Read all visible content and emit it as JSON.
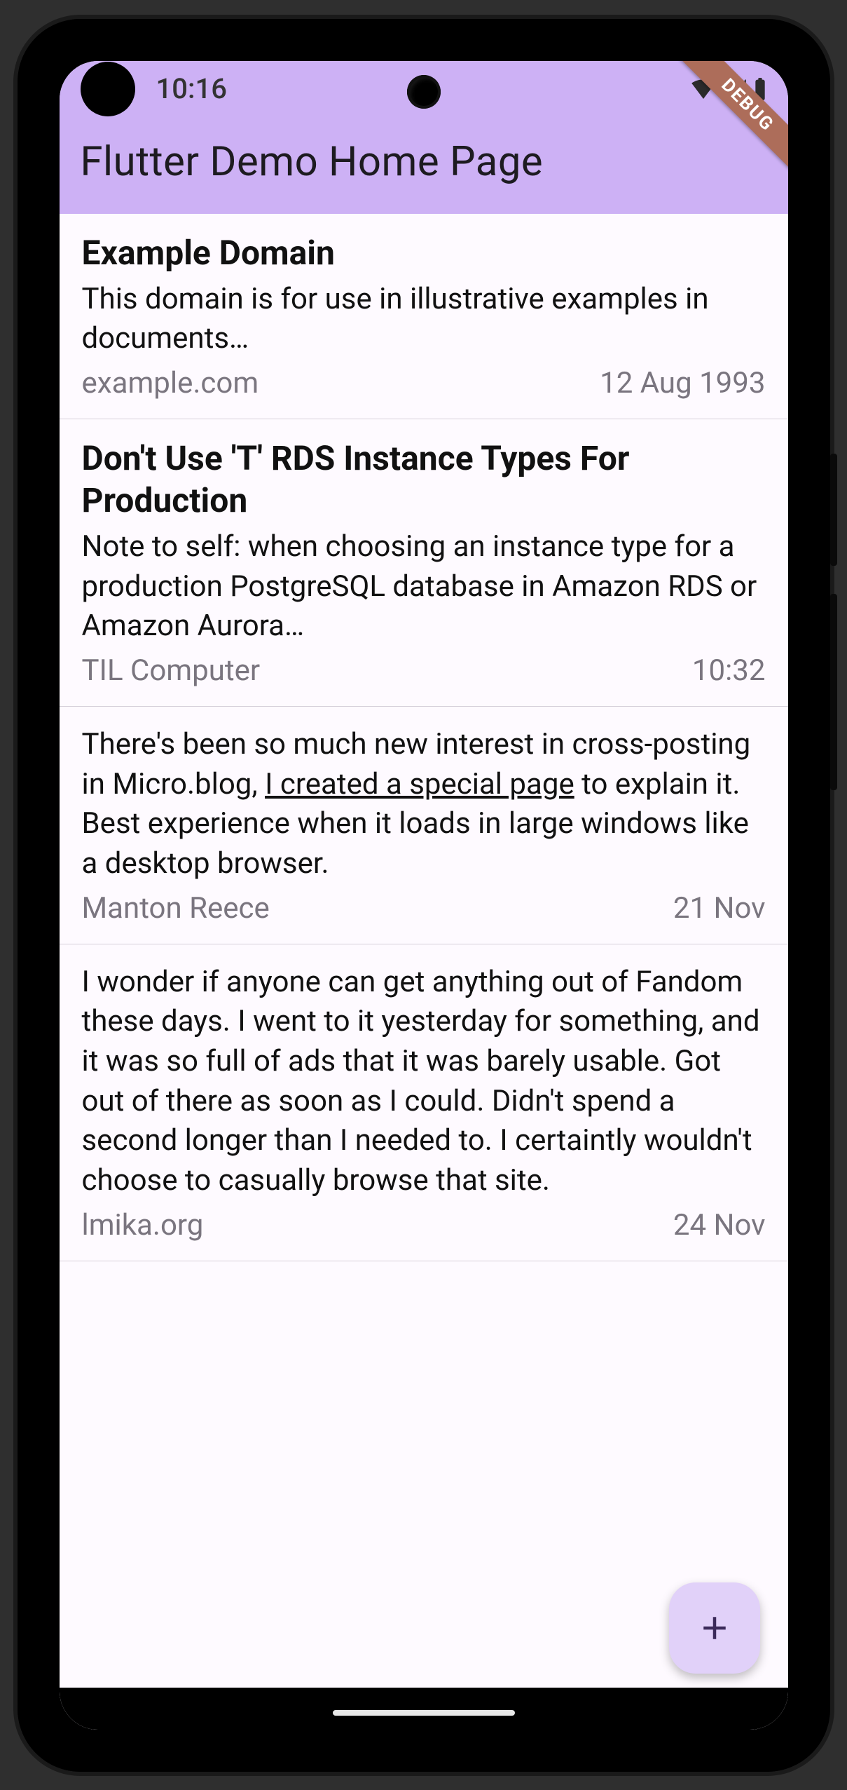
{
  "status": {
    "time": "10:16"
  },
  "debug_banner": "DEBUG",
  "appbar": {
    "title": "Flutter Demo Home Page"
  },
  "feed": [
    {
      "title": "Example Domain",
      "body": "This domain is for use in illustrative examples in documents…",
      "source": "example.com",
      "stamp": "12 Aug 1993"
    },
    {
      "title": "Don't Use 'T' RDS Instance Types For Production",
      "body": "Note to self: when choosing an instance type for a production PostgreSQL database in Amazon RDS or Amazon Aurora…",
      "source": "TIL Computer",
      "stamp": "10:32"
    },
    {
      "title": "",
      "body_pre": "There's been so much new interest in cross-posting in Micro.blog, ",
      "body_link": "I created a special page",
      "body_post": " to explain it. Best experience when it loads in large windows like a desktop browser.",
      "source": "Manton Reece",
      "stamp": "21 Nov"
    },
    {
      "title": "",
      "body": "I wonder if anyone can get anything out of Fandom these days. I went to it yesterday for something, and it was so full of ads that it was barely usable. Got out of there as soon as I could. Didn't spend a second longer than I needed to. I certaintly wouldn't choose to casually browse that site.",
      "source": "lmika.org",
      "stamp": "24 Nov"
    }
  ]
}
